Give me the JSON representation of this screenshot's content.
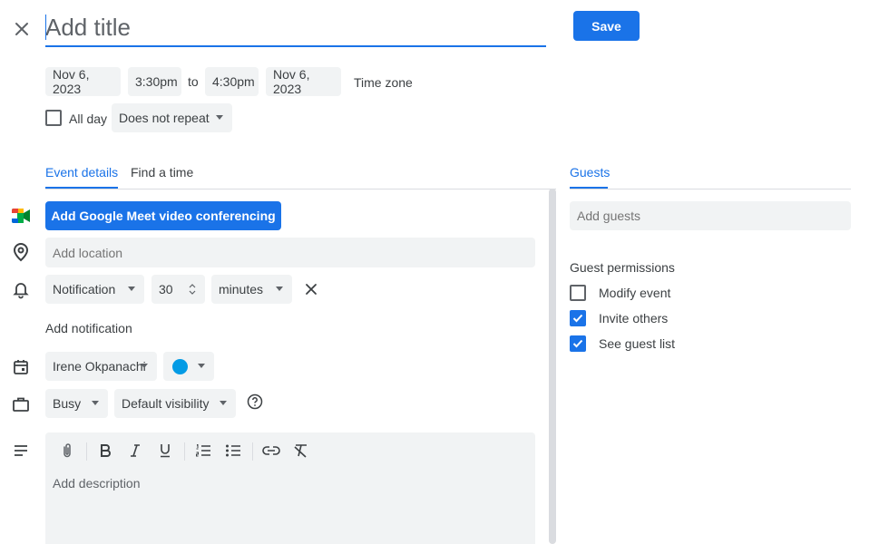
{
  "header": {
    "title_placeholder": "Add title",
    "save_label": "Save"
  },
  "datetime": {
    "start_date": "Nov 6, 2023",
    "start_time": "3:30pm",
    "to_label": "to",
    "end_time": "4:30pm",
    "end_date": "Nov 6, 2023",
    "timezone_label": "Time zone",
    "all_day_label": "All day",
    "repeat_value": "Does not repeat"
  },
  "tabs": {
    "event_details": "Event details",
    "find_time": "Find a time"
  },
  "details": {
    "meet_button": "Add Google Meet video conferencing",
    "location_placeholder": "Add location",
    "notification_type": "Notification",
    "notification_amount": "30",
    "notification_unit": "minutes",
    "add_notification": "Add notification",
    "calendar_owner": "Irene Okpanachi",
    "calendar_color": "#039be5",
    "busy_value": "Busy",
    "visibility_value": "Default visibility",
    "description_placeholder": "Add description"
  },
  "guests": {
    "tab_label": "Guests",
    "add_placeholder": "Add guests",
    "permissions_title": "Guest permissions",
    "modify_event": "Modify event",
    "invite_others": "Invite others",
    "see_guest_list": "See guest list"
  },
  "colors": {
    "accent": "#1a73e8",
    "field_bg": "#f1f3f4"
  },
  "icons": {
    "close": "close-icon",
    "meet": "google-meet-icon",
    "location": "location-pin-icon",
    "notification": "bell-icon",
    "calendar": "calendar-icon",
    "busy": "briefcase-icon",
    "help": "help-circle-icon",
    "description": "notes-icon"
  }
}
